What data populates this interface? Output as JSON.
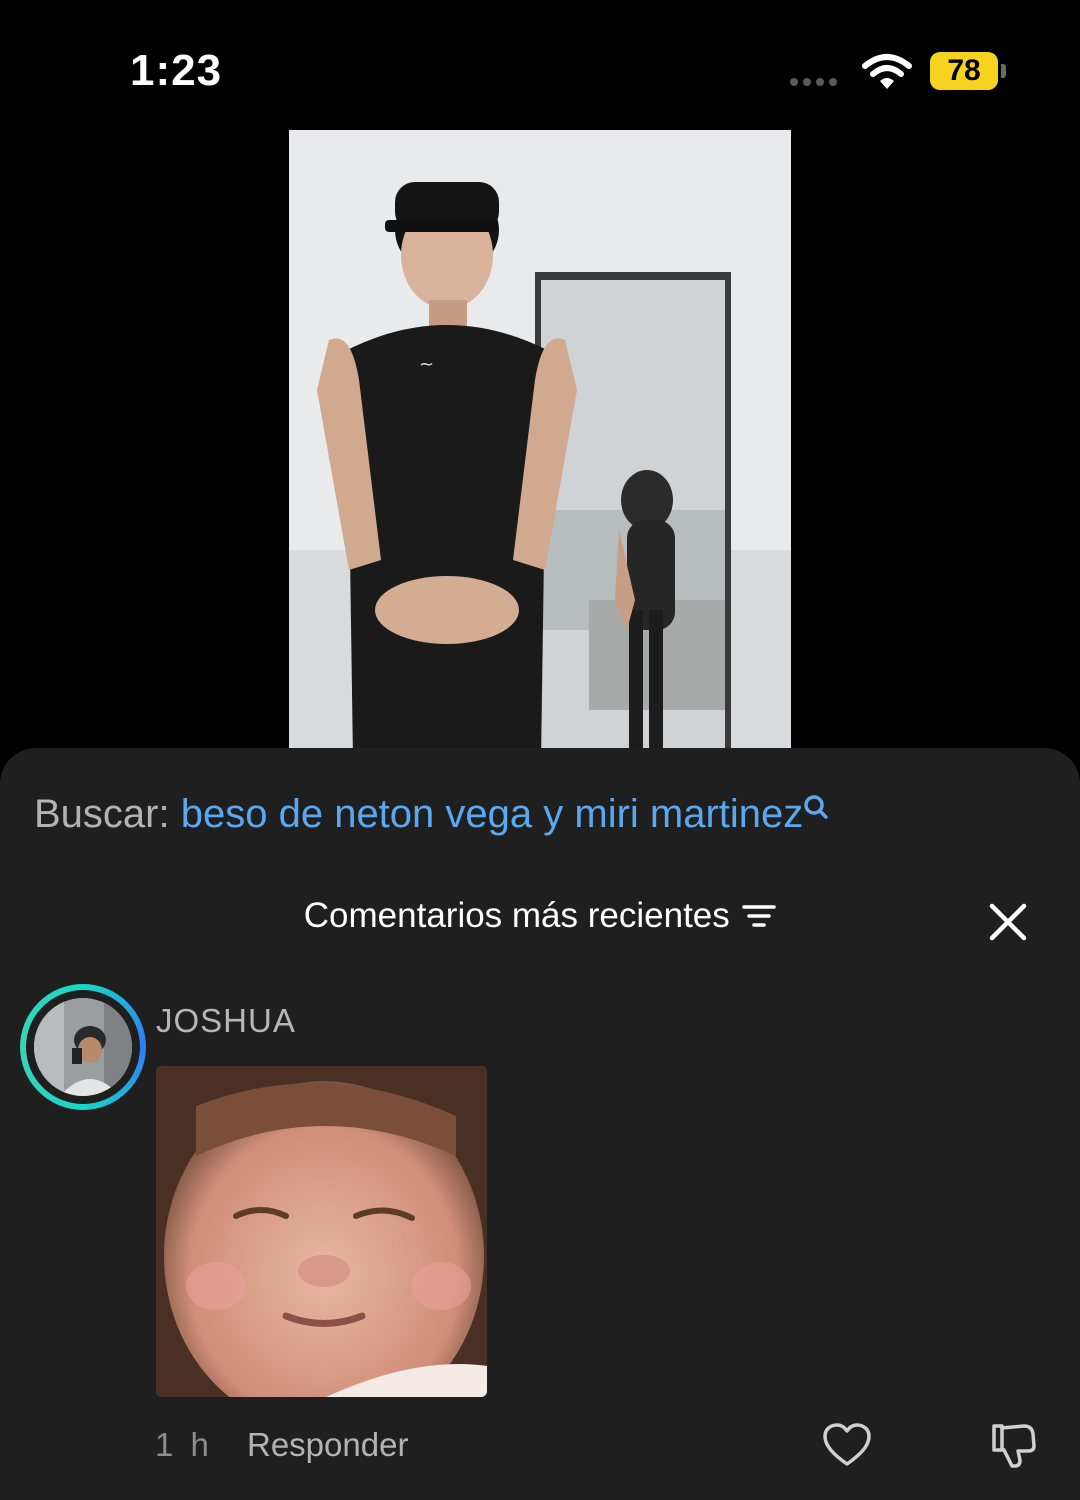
{
  "status_bar": {
    "time": "1:23",
    "battery_level": "78",
    "battery_color": "#f6d31f",
    "icons": [
      "signal-dots-icon",
      "wifi-icon",
      "battery-icon"
    ]
  },
  "video": {
    "description_icon": "video-thumbnail"
  },
  "search": {
    "prefix": "Buscar:",
    "query": "beso de neton vega y miri martinez",
    "query_color": "#5aa8f0",
    "icon": "search-icon"
  },
  "comments_header": {
    "title": "Comentarios más recientes",
    "sort_icon": "filter-sort-icon",
    "close_icon": "close-icon"
  },
  "comment": {
    "username": "JOSHUA",
    "time": "1 h",
    "reply_label": "Responder",
    "like_icon": "heart-icon",
    "dislike_icon": "thumbs-down-icon",
    "avatar_ring_colors": [
      "#19d7c6",
      "#2f7cf0"
    ]
  }
}
